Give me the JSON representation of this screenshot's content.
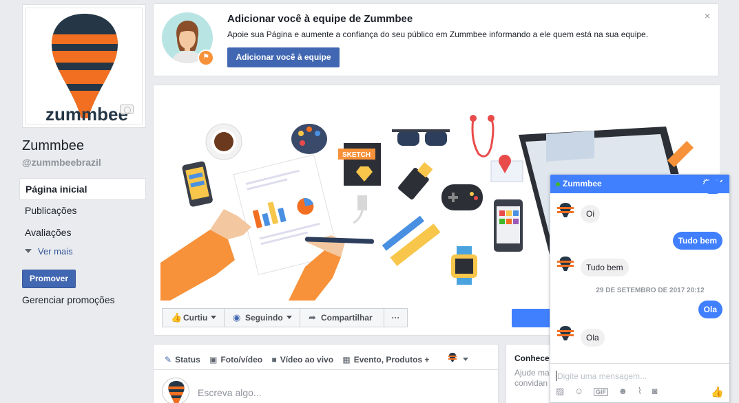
{
  "page": {
    "name": "Zummbee",
    "handle": "@zummbeebrazil",
    "logo_text": "zummbee"
  },
  "nav": {
    "items": [
      {
        "label": "Página inicial",
        "active": true
      },
      {
        "label": "Publicações",
        "active": false
      },
      {
        "label": "Avaliações",
        "active": false
      }
    ],
    "see_more": "Ver mais",
    "promote_button": "Promover",
    "manage_promotions": "Gerenciar promoções"
  },
  "team_prompt": {
    "title": "Adicionar você à equipe de Zummbee",
    "description": "Apoie sua Página e aumente a confiança do seu público em Zummbee informando a ele quem está na sua equipe.",
    "button": "Adicionar você à equipe",
    "close": "×"
  },
  "cover": {
    "sketch_label": "SKETCH",
    "actions": [
      {
        "label": "Curtiu",
        "icon": "thumbs-up-icon",
        "glyph": "👍",
        "dropdown": true
      },
      {
        "label": "Seguindo",
        "icon": "rss-icon",
        "glyph": "◉",
        "dropdown": true
      },
      {
        "label": "Compartilhar",
        "icon": "share-icon",
        "glyph": "➦",
        "dropdown": false
      },
      {
        "label": "···",
        "icon": "more-icon",
        "glyph": "",
        "dropdown": false
      }
    ]
  },
  "composer": {
    "tabs": [
      {
        "label": "Status",
        "glyph": "✎"
      },
      {
        "label": "Foto/vídeo",
        "glyph": "▣"
      },
      {
        "label": "Vídeo ao vivo",
        "glyph": "■"
      },
      {
        "label": "Evento, Produtos +",
        "glyph": "▦"
      }
    ],
    "placeholder": "Escreva algo..."
  },
  "side_card": {
    "title": "Conhece",
    "text": "Ajude ma convidan"
  },
  "chat": {
    "name": "Zummbee",
    "date_label": "29 DE SETEMBRO DE 2017 20:12",
    "messages": [
      {
        "text": "Oi",
        "dir": "in"
      },
      {
        "text": "Tudo bem",
        "dir": "out"
      },
      {
        "text": "Tudo bem",
        "dir": "in"
      },
      {
        "text": "Ola",
        "dir": "out"
      },
      {
        "text": "Ola",
        "dir": "in"
      }
    ],
    "input_placeholder": "Digite uma mensagem...",
    "tools": [
      "image-icon",
      "sticker-icon",
      "gif-icon",
      "emoji-icon",
      "attach-icon",
      "camera-icon"
    ],
    "tool_glyphs": [
      "▨",
      "☺",
      "GIF",
      "☻",
      "⌇",
      "◙"
    ]
  },
  "colors": {
    "brand_blue": "#4267b2",
    "messenger_blue": "#4080ff",
    "logo_orange": "#f26f21",
    "logo_dark": "#253746"
  }
}
